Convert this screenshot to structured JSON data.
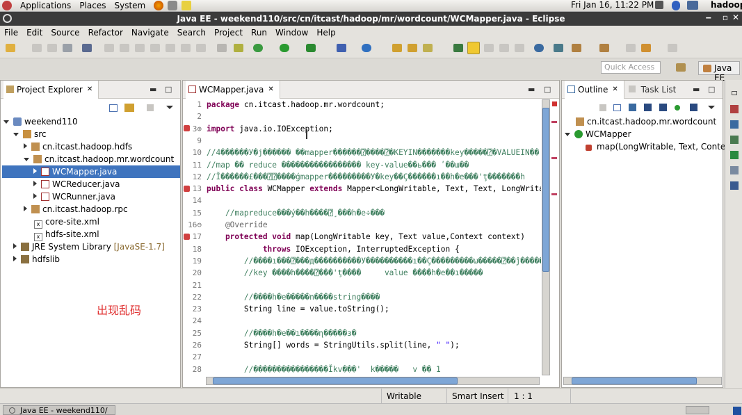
{
  "panel": {
    "menus": [
      "Applications",
      "Places",
      "System"
    ],
    "clock": "Fri Jan 16, 11:22 PM",
    "user": "hadoop"
  },
  "window": {
    "title": "Java EE - weekend110/src/cn/itcast/hadoop/mr/wordcount/WCMapper.java - Eclipse",
    "controls": [
      "‒",
      "▫",
      "✕"
    ]
  },
  "menubar": [
    "File",
    "Edit",
    "Source",
    "Refactor",
    "Navigate",
    "Search",
    "Project",
    "Run",
    "Window",
    "Help"
  ],
  "toolbar": {
    "quick_access_placeholder": "Quick Access",
    "perspective": "Java EE"
  },
  "project_explorer": {
    "tab": "Project Explorer",
    "tab_close": "✕",
    "items": [
      {
        "label": "weekend110",
        "icon": "project-icon",
        "twisty": "open"
      },
      {
        "label": "src",
        "icon": "source-folder-icon",
        "twisty": "open"
      },
      {
        "label": "cn.itcast.hadoop.hdfs",
        "icon": "package-icon",
        "twisty": "closed"
      },
      {
        "label": "cn.itcast.hadoop.mr.wordcount",
        "icon": "package-icon",
        "twisty": "open"
      },
      {
        "label": "WCMapper.java",
        "icon": "java-file-icon",
        "twisty": "closed",
        "selected": true
      },
      {
        "label": "WCReducer.java",
        "icon": "java-file-icon",
        "twisty": "closed"
      },
      {
        "label": "WCRunner.java",
        "icon": "java-file-icon",
        "twisty": "closed"
      },
      {
        "label": "cn.itcast.hadoop.rpc",
        "icon": "package-icon",
        "twisty": "closed"
      },
      {
        "label": "core-site.xml",
        "icon": "xml-file-icon",
        "twisty": "none"
      },
      {
        "label": "hdfs-site.xml",
        "icon": "xml-file-icon",
        "twisty": "none"
      },
      {
        "label": "JRE System Library",
        "suffix": "[JavaSE-1.7]",
        "icon": "library-icon",
        "twisty": "closed"
      },
      {
        "label": "hdfslib",
        "icon": "library-icon",
        "twisty": "closed"
      }
    ],
    "annotation": "出现乱码",
    "annotation_color": "#e03030"
  },
  "editor": {
    "tab": "WCMapper.java",
    "tab_close": "✕",
    "lines": [
      {
        "n": "1",
        "t": [
          [
            "kw",
            "package"
          ],
          [
            "",
            " cn.itcast.hadoop.mr.wordcount;"
          ]
        ]
      },
      {
        "n": "2",
        "t": []
      },
      {
        "n": "3⊕",
        "t": [
          [
            "kw",
            "import"
          ],
          [
            "",
            " java.io.IOException;"
          ]
        ]
      },
      {
        "n": "9",
        "t": []
      },
      {
        "n": "10",
        "t": [
          [
            "cm",
            "//4������У�j������ ��mapper������⍰����⍰�KEYIN�������key�����⍰�VALUEIN��"
          ]
        ]
      },
      {
        "n": "11",
        "t": [
          [
            "cm",
            "//map �� reduce ����������������� key-value��ь��� ʹ��ɯ��"
          ]
        ]
      },
      {
        "n": "12",
        "t": [
          [
            "cm",
            "//Ĭ������£���⍰⍰����ǵmapper���������У�key��Ç������ı��h�e���'ţ�������h"
          ]
        ]
      },
      {
        "n": "13",
        "t": [
          [
            "kw",
            "public class"
          ],
          [
            "",
            " WCMapper "
          ],
          [
            "kw",
            "extends"
          ],
          [
            "",
            " Mapper<LongWritable, Text, Text, LongWritable>"
          ]
        ]
      },
      {
        "n": "14",
        "t": []
      },
      {
        "n": "15",
        "t": [
          [
            "cm",
            "    //mapreduce���ý��h����⍰˼���h�e÷���"
          ]
        ]
      },
      {
        "n": "16⊖",
        "t": [
          [
            "an",
            "    @Override"
          ]
        ]
      },
      {
        "n": "17",
        "t": [
          [
            "kw",
            "    protected void"
          ],
          [
            "",
            " map(LongWritable key, Text value,Context context)"
          ]
        ]
      },
      {
        "n": "18",
        "t": [
          [
            "kw",
            "            throws"
          ],
          [
            "",
            " IOException, InterruptedException {"
          ]
        ]
      },
      {
        "n": "19",
        "t": [
          [
            "cm",
            "        //����ı���⍰���д����������У����������ı��Ç���������ω�����⍰��ĵ�����"
          ]
        ]
      },
      {
        "n": "20",
        "t": [
          [
            "cm",
            "        //key ����h����⍰���'ţ����     value ����h�e��ı�����"
          ]
        ]
      },
      {
        "n": "21",
        "t": []
      },
      {
        "n": "22",
        "t": [
          [
            "cm",
            "        //����h�e�����n����string����"
          ]
        ]
      },
      {
        "n": "23",
        "t": [
          [
            "",
            "        String line = value.toString();"
          ]
        ]
      },
      {
        "n": "24",
        "t": []
      },
      {
        "n": "25",
        "t": [
          [
            "cm",
            "        //����h�e��ı����ղ�����з�"
          ]
        ]
      },
      {
        "n": "26",
        "t": [
          [
            "",
            "        String[] words = StringUtils.split(line, "
          ],
          [
            "st",
            "\" \""
          ],
          [
            "",
            ");"
          ]
        ]
      },
      {
        "n": "27",
        "t": []
      },
      {
        "n": "28",
        "t": [
          [
            "cm",
            "        //����������������Ĭkv���'  k�����   v �� 1"
          ]
        ]
      }
    ]
  },
  "outline": {
    "tab": "Outline",
    "tab_close": "✕",
    "task_tab": "Task List",
    "items": [
      {
        "label": "cn.itcast.hadoop.mr.wordcount",
        "icon": "package-icon"
      },
      {
        "label": "WCMapper",
        "icon": "class-icon"
      },
      {
        "label": "map(LongWritable, Text, Context) :",
        "icon": "method-icon"
      }
    ]
  },
  "status": {
    "writable": "Writable",
    "insert_mode": "Smart Insert",
    "position": "1 : 1"
  },
  "taskbar": {
    "window": "Java EE - weekend110/"
  }
}
